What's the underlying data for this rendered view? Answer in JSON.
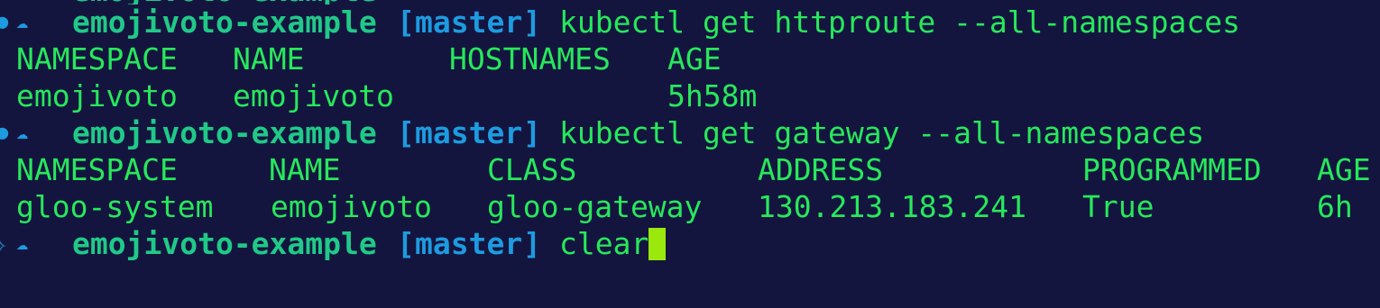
{
  "theme": {
    "background": "#14153f",
    "text_green": "#27e85b",
    "dir_teal": "#20c987",
    "branch_blue": "#1d9be0",
    "cursor_lime": "#9be80d"
  },
  "prompts": [
    {
      "dir": "emojivoto-example",
      "branch_open": "[",
      "branch": "master",
      "branch_close": "]",
      "command": "kubectl get httproute --all-namespaces"
    },
    {
      "dir": "emojivoto-example",
      "branch_open": "[",
      "branch": "master",
      "branch_close": "]",
      "command": "kubectl get gateway --all-namespaces"
    },
    {
      "dir": "emojivoto-example",
      "branch_open": "[",
      "branch": "master",
      "branch_close": "]",
      "command": "clear"
    }
  ],
  "httproute_table": {
    "headers": [
      "NAMESPACE",
      "NAME",
      "HOSTNAMES",
      "AGE"
    ],
    "rows": [
      [
        "emojivoto",
        "emojivoto",
        "",
        "5h58m"
      ]
    ]
  },
  "gateway_table": {
    "headers": [
      "NAMESPACE",
      "NAME",
      "CLASS",
      "ADDRESS",
      "PROGRAMMED",
      "AGE"
    ],
    "rows": [
      [
        "gloo-system",
        "emojivoto",
        "gloo-gateway",
        "130.213.183.241",
        "True",
        "6h"
      ]
    ]
  },
  "icons": {
    "prompt_glyph": "☁",
    "gutter_glyph": "●",
    "status_glyph": "✧"
  }
}
